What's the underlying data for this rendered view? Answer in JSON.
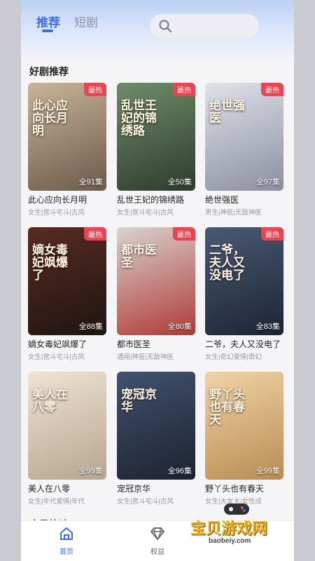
{
  "header": {
    "tabs": [
      {
        "label": "推荐",
        "active": true
      },
      {
        "label": "短剧",
        "active": false
      }
    ],
    "search": {
      "placeholder": ""
    }
  },
  "section_hot": {
    "title": "好剧推荐"
  },
  "section_member": {
    "title": "会员热映"
  },
  "dramas": [
    {
      "poster_title": "此心应向长月明",
      "title": "此心应向长月明",
      "tags": "女生|宫斗宅斗|古风",
      "badge": "最热",
      "episodes": "全91集",
      "colors": [
        "#c9b39a",
        "#6d5a4a"
      ]
    },
    {
      "poster_title": "乱世王妃的锦绣路",
      "title": "乱世王妃的锦绣路",
      "tags": "女生|宫斗宅斗|古风",
      "badge": "最热",
      "episodes": "全50集",
      "colors": [
        "#6f8c6a",
        "#2f3b2e"
      ]
    },
    {
      "poster_title": "绝世强医",
      "title": "绝世强医",
      "tags": "男生|神医|无敌神医",
      "badge": "最热",
      "episodes": "全97集",
      "colors": [
        "#dfe2ea",
        "#8c8fa0"
      ]
    },
    {
      "poster_title": "嫡女毒妃飒爆了",
      "title": "嫡女毒妃飒爆了",
      "tags": "女生|宫斗宅斗|古风",
      "badge": "最热",
      "episodes": "全88集",
      "colors": [
        "#5a2a22",
        "#1e1512"
      ]
    },
    {
      "poster_title": "都市医圣",
      "title": "都市医圣",
      "tags": "通用|神医|无敌神医",
      "badge": "最热",
      "episodes": "全80集",
      "colors": [
        "#d8d3cf",
        "#b03a36"
      ]
    },
    {
      "poster_title": "二爷，夫人又没电了",
      "title": "二爷，夫人又没电了",
      "tags": "女生|奇幻爱情|奇幻",
      "badge": "最热",
      "episodes": "全83集",
      "colors": [
        "#4a5a74",
        "#1d2433"
      ]
    },
    {
      "poster_title": "美人在八零",
      "title": "美人在八零",
      "tags": "女生|年代爱情|年代",
      "badge": "",
      "episodes": "全99集",
      "colors": [
        "#efe3d3",
        "#b7a58f"
      ]
    },
    {
      "poster_title": "宠冠京华",
      "title": "宠冠京华",
      "tags": "女生|宫斗宅斗|古风",
      "badge": "",
      "episodes": "全96集",
      "colors": [
        "#42526e",
        "#1d2230"
      ]
    },
    {
      "poster_title": "野丫头也有春天",
      "title": "野丫头也有春天",
      "tags": "女生|大女主|女性成",
      "badge": "",
      "episodes": "全99集",
      "colors": [
        "#f0d3a6",
        "#b98c52"
      ]
    }
  ],
  "bottom_nav": [
    {
      "label": "首页",
      "icon": "home-icon",
      "active": true
    },
    {
      "label": "权益",
      "icon": "diamond-icon",
      "active": false
    }
  ],
  "watermark": {
    "title": "宝贝游戏网",
    "url": "baobeiy.com"
  },
  "colors": {
    "accent": "#3a6ee8",
    "hot_badge": "#e64552"
  }
}
